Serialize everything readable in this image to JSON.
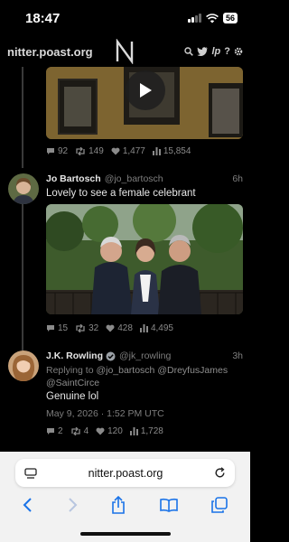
{
  "status_bar": {
    "time": "18:47",
    "battery": "56"
  },
  "nav": {
    "brand": "nitter.poast.org",
    "tip_icon_label": "lp",
    "help_label": "?"
  },
  "tweets": [
    {
      "stats": {
        "replies": "92",
        "retweets": "149",
        "likes": "1,477",
        "views": "15,854"
      }
    },
    {
      "name": "Jo Bartosch",
      "handle": "@jo_bartosch",
      "time": "6h",
      "text": "Lovely to see a female celebrant",
      "stats": {
        "replies": "15",
        "retweets": "32",
        "likes": "428",
        "views": "4,495"
      }
    },
    {
      "name": "J.K. Rowling",
      "handle": "@jk_rowling",
      "time": "3h",
      "replying_prefix": "Replying to",
      "replying_to": [
        "@jo_bartosch",
        "@DreyfusJames",
        "@SaintCirce"
      ],
      "text": "Genuine lol",
      "date": "May 9, 2026 · 1:52 PM UTC",
      "stats": {
        "replies": "2",
        "retweets": "4",
        "likes": "120",
        "views": "1,728"
      }
    }
  ],
  "browser": {
    "url": "nitter.poast.org"
  },
  "colors": {
    "background": "#000000",
    "text": "#e6e6e6",
    "muted": "#7e7e7e",
    "toolbar_blue": "#1a73e8",
    "verified": "#1d9bf0"
  }
}
